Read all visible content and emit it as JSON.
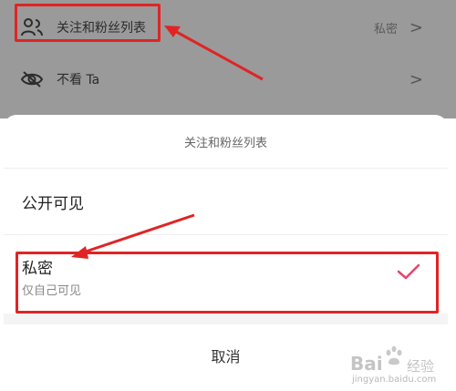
{
  "list": {
    "rows": [
      {
        "label": "关注和粉丝列表",
        "value": "私密",
        "icon": "users-icon",
        "chevron": ">"
      },
      {
        "label": "不看 Ta",
        "value": "",
        "icon": "eye-off-icon",
        "chevron": ">"
      }
    ]
  },
  "sheet": {
    "title": "关注和粉丝列表",
    "options": [
      {
        "label": "公开可见",
        "sub": "",
        "selected": false
      },
      {
        "label": "私密",
        "sub": "仅自己可见",
        "selected": true
      }
    ],
    "cancel_label": "取消"
  },
  "watermark": {
    "brand": "Bai",
    "brand_suffix": "经验",
    "url": "jingyan.baidu.com"
  },
  "colors": {
    "highlight": "#e02424",
    "check": "#e8456b",
    "overlay": "#9a9a9a"
  }
}
